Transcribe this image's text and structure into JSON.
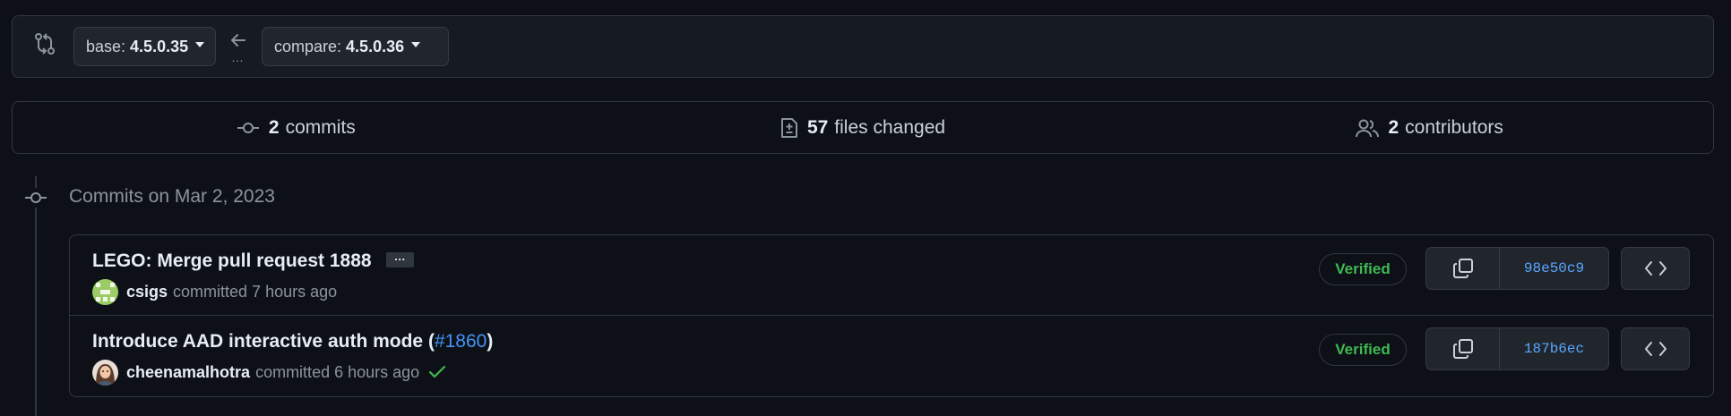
{
  "range": {
    "base_prefix": "base:",
    "base_value": "4.5.0.35",
    "compare_prefix": "compare:",
    "compare_value": "4.5.0.36",
    "swap_dots": "…"
  },
  "summary": {
    "commits": {
      "count": "2",
      "label": "commits",
      "icon": "git-commit-icon"
    },
    "files": {
      "count": "57",
      "label": "files changed",
      "icon": "file-diff-icon"
    },
    "contributors": {
      "count": "2",
      "label": "contributors",
      "icon": "people-icon"
    }
  },
  "timeline": {
    "date_heading": "Commits on Mar 2, 2023"
  },
  "commits": [
    {
      "title": "LEGO: Merge pull request 1888",
      "author": "csigs",
      "action": "committed 7 hours ago",
      "verified": "Verified",
      "sha": "98e50c9",
      "has_ellipsis": true,
      "ellipsis": "…",
      "status": null
    },
    {
      "title_prefix": "Introduce AAD interactive auth mode (",
      "pr_link": "#1860",
      "title_suffix": ")",
      "author": "cheenamalhotra",
      "action": "committed 6 hours ago",
      "verified": "Verified",
      "sha": "187b6ec",
      "status": "success-check-icon"
    }
  ],
  "colors": {
    "background": "#0d1117",
    "border": "#30363d",
    "verified": "#3fb950",
    "link": "#4493f8",
    "muted": "#8b949e"
  }
}
